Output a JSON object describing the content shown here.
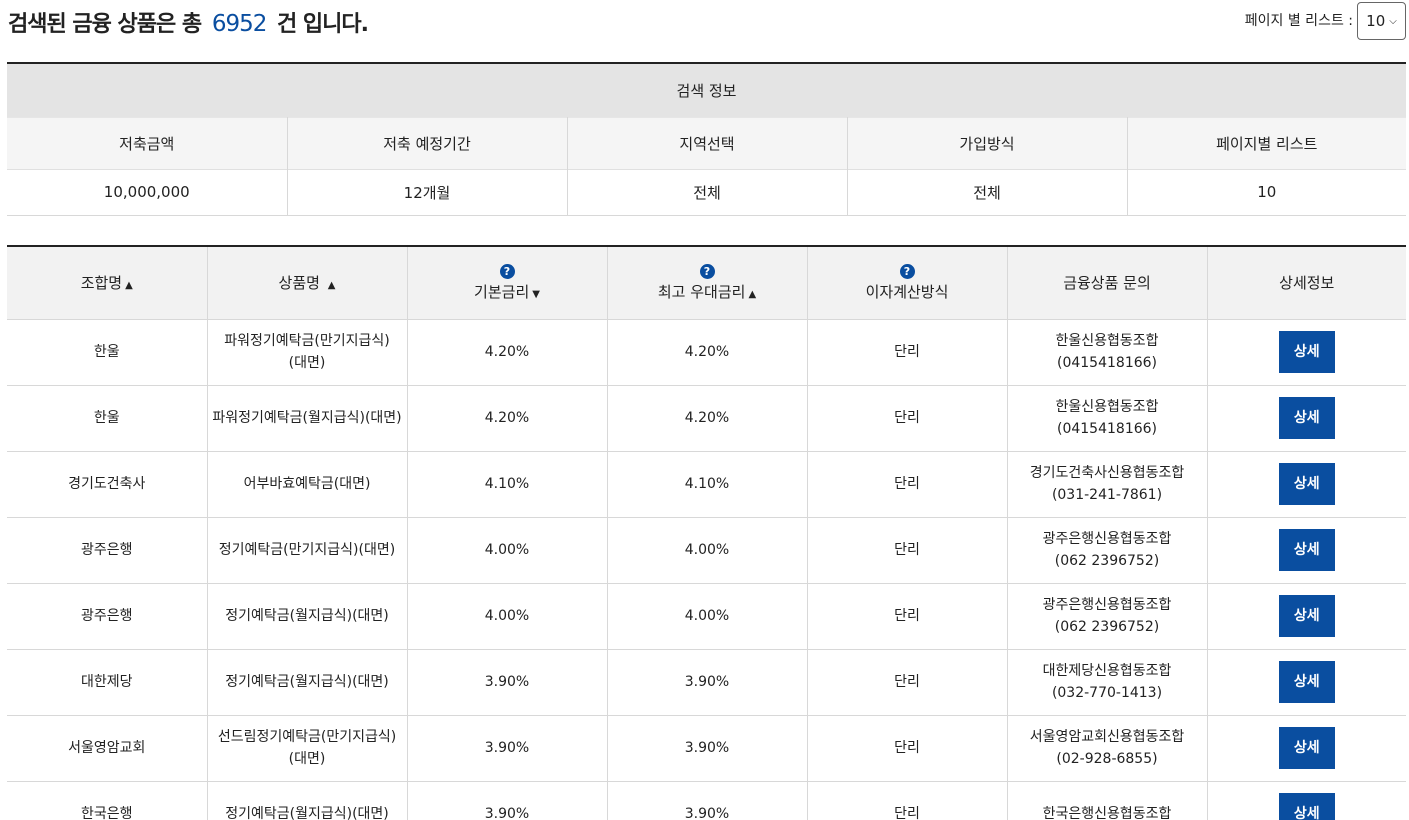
{
  "header": {
    "title_prefix": "검색된 금융 상품은 총",
    "total_count": "6952",
    "title_suffix": "건 입니다."
  },
  "per_page": {
    "label": "페이지 별 리스트 :",
    "selected": "10"
  },
  "search_info": {
    "caption": "검색 정보",
    "headers": [
      "저축금액",
      "저축 예정기간",
      "지역선택",
      "가입방식",
      "페이지별 리스트"
    ],
    "values": [
      "10,000,000",
      "12개월",
      "전체",
      "전체",
      "10"
    ]
  },
  "table": {
    "headers": {
      "union": "조합명",
      "product": "상품명",
      "base_rate": "기본금리",
      "max_rate": "최고 우대금리",
      "calc_method": "이자계산방식",
      "inquiry": "금융상품 문의",
      "detail": "상세정보"
    },
    "help_glyph": "?",
    "sort_up": "▲",
    "sort_down": "▼",
    "detail_button": "상세",
    "rows": [
      {
        "union": "한울",
        "product_line1": "파워정기예탁금(만기지급식)",
        "product_line2": "(대면)",
        "base_rate": "4.20%",
        "max_rate": "4.20%",
        "method": "단리",
        "inquiry_name": "한울신용협동조합",
        "inquiry_phone": "(0415418166)"
      },
      {
        "union": "한울",
        "product_line1": "파워정기예탁금(월지급식)(대면)",
        "product_line2": "",
        "base_rate": "4.20%",
        "max_rate": "4.20%",
        "method": "단리",
        "inquiry_name": "한울신용협동조합",
        "inquiry_phone": "(0415418166)"
      },
      {
        "union": "경기도건축사",
        "product_line1": "어부바효예탁금(대면)",
        "product_line2": "",
        "base_rate": "4.10%",
        "max_rate": "4.10%",
        "method": "단리",
        "inquiry_name": "경기도건축사신용협동조합",
        "inquiry_phone": "(031-241-7861)"
      },
      {
        "union": "광주은행",
        "product_line1": "정기예탁금(만기지급식)(대면)",
        "product_line2": "",
        "base_rate": "4.00%",
        "max_rate": "4.00%",
        "method": "단리",
        "inquiry_name": "광주은행신용협동조합",
        "inquiry_phone": "(062 2396752)"
      },
      {
        "union": "광주은행",
        "product_line1": "정기예탁금(월지급식)(대면)",
        "product_line2": "",
        "base_rate": "4.00%",
        "max_rate": "4.00%",
        "method": "단리",
        "inquiry_name": "광주은행신용협동조합",
        "inquiry_phone": "(062 2396752)"
      },
      {
        "union": "대한제당",
        "product_line1": "정기예탁금(월지급식)(대면)",
        "product_line2": "",
        "base_rate": "3.90%",
        "max_rate": "3.90%",
        "method": "단리",
        "inquiry_name": "대한제당신용협동조합",
        "inquiry_phone": "(032-770-1413)"
      },
      {
        "union": "서울영암교회",
        "product_line1": "선드림정기예탁금(만기지급식)",
        "product_line2": "(대면)",
        "base_rate": "3.90%",
        "max_rate": "3.90%",
        "method": "단리",
        "inquiry_name": "서울영암교회신용협동조합",
        "inquiry_phone": "(02-928-6855)"
      },
      {
        "union": "한국은행",
        "product_line1": "정기예탁금(월지급식)(대면)",
        "product_line2": "",
        "base_rate": "3.90%",
        "max_rate": "3.90%",
        "method": "단리",
        "inquiry_name": "한국은행신용협동조합",
        "inquiry_phone": ""
      }
    ]
  },
  "colors": {
    "accent": "#0a4ea0",
    "header_bg": "#f2f2f2",
    "caption_bg": "#e4e4e4"
  }
}
